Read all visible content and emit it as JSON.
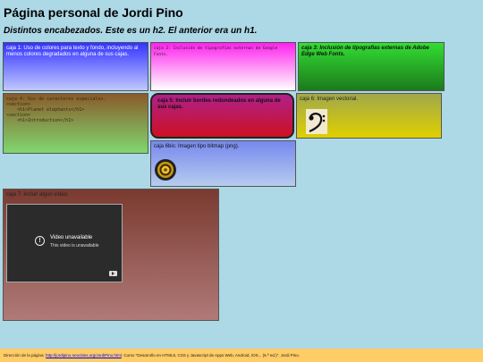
{
  "page": {
    "h1": "Página personal de Jordi Pino",
    "h2": "Distintos encabezados. Este es un h2. El anterior era un h1."
  },
  "boxes": {
    "c1": "caja 1: Uso de colores para texto y fondo, incluyendo al menos colores degradados en alguna de sus cajas.",
    "c2": "caja 2: Inclusión de tipografías externas de Google Fonts.",
    "c3": "caja 3: Inclusión de tipografías externas de Adobe Edge Web Fonts.",
    "c4_label": "caja 4: Uso de caracteres especiales.",
    "c4_code": "<section>\n    <h1>Planet elephants</h1>\n<section>\n    <h1>Introduction</h1>",
    "c5": "caja 5: Incluir bordes redondeados en alguna de sus cajas.",
    "c6": "caja 6: Imagen vectorial.",
    "c6bis": "caja 6bis: Imagen tipo bitmap (png).",
    "c7": "caja 7: Incluir algún vídeo.",
    "video_title": "Video unavailable",
    "video_sub": "This video is unavailable"
  },
  "footer": {
    "prefix": "Dirección de la página:",
    "link": "http://jordipino.neocities.org/JordiPino.html",
    "suffix": ". Curso \"Desarrollo en HTML5, CSS y Javascript de Apps Web, Android, IOS... (6.ª ed.)\". Jordi Pino."
  },
  "icons": [
    "bass-clef-icon",
    "speaker-icon",
    "info-icon",
    "youtube-icon"
  ],
  "colors": {
    "background": "#add8e6",
    "footer": "#ffcc66"
  }
}
